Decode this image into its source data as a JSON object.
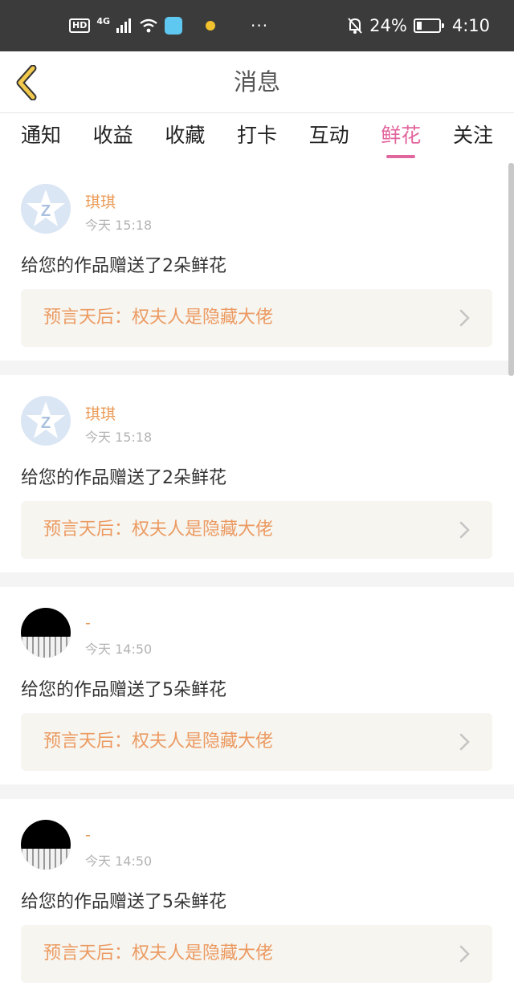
{
  "status_bar": {
    "network": "HD",
    "signal": "4G",
    "battery_percent": "24%",
    "time": "4:10",
    "more": "···"
  },
  "header": {
    "title": "消息",
    "back_icon": "chevron-left-icon"
  },
  "tabs": [
    {
      "label": "通知",
      "active": false
    },
    {
      "label": "收益",
      "active": false
    },
    {
      "label": "收藏",
      "active": false
    },
    {
      "label": "打卡",
      "active": false
    },
    {
      "label": "互动",
      "active": false
    },
    {
      "label": "鲜花",
      "active": true
    },
    {
      "label": "关注",
      "active": false
    }
  ],
  "messages": [
    {
      "user": "琪琪",
      "time": "今天 15:18",
      "text": "给您的作品赠送了2朵鲜花",
      "work_title": "预言天后：权夫人是隐藏大佬",
      "avatar": "default-z"
    },
    {
      "user": "琪琪",
      "time": "今天 15:18",
      "text": "给您的作品赠送了2朵鲜花",
      "work_title": "预言天后：权夫人是隐藏大佬",
      "avatar": "default-z"
    },
    {
      "user": "-",
      "time": "今天 14:50",
      "text": "给您的作品赠送了5朵鲜花",
      "work_title": "预言天后：权夫人是隐藏大佬",
      "avatar": "photo"
    },
    {
      "user": "-",
      "time": "今天 14:50",
      "text": "给您的作品赠送了5朵鲜花",
      "work_title": "预言天后：权夫人是隐藏大佬",
      "avatar": "photo"
    }
  ],
  "colors": {
    "accent_pink": "#e2669e",
    "name_orange": "#eb9a55",
    "link_orange": "#ec9a62",
    "back_yellow": "#f2c94c"
  }
}
